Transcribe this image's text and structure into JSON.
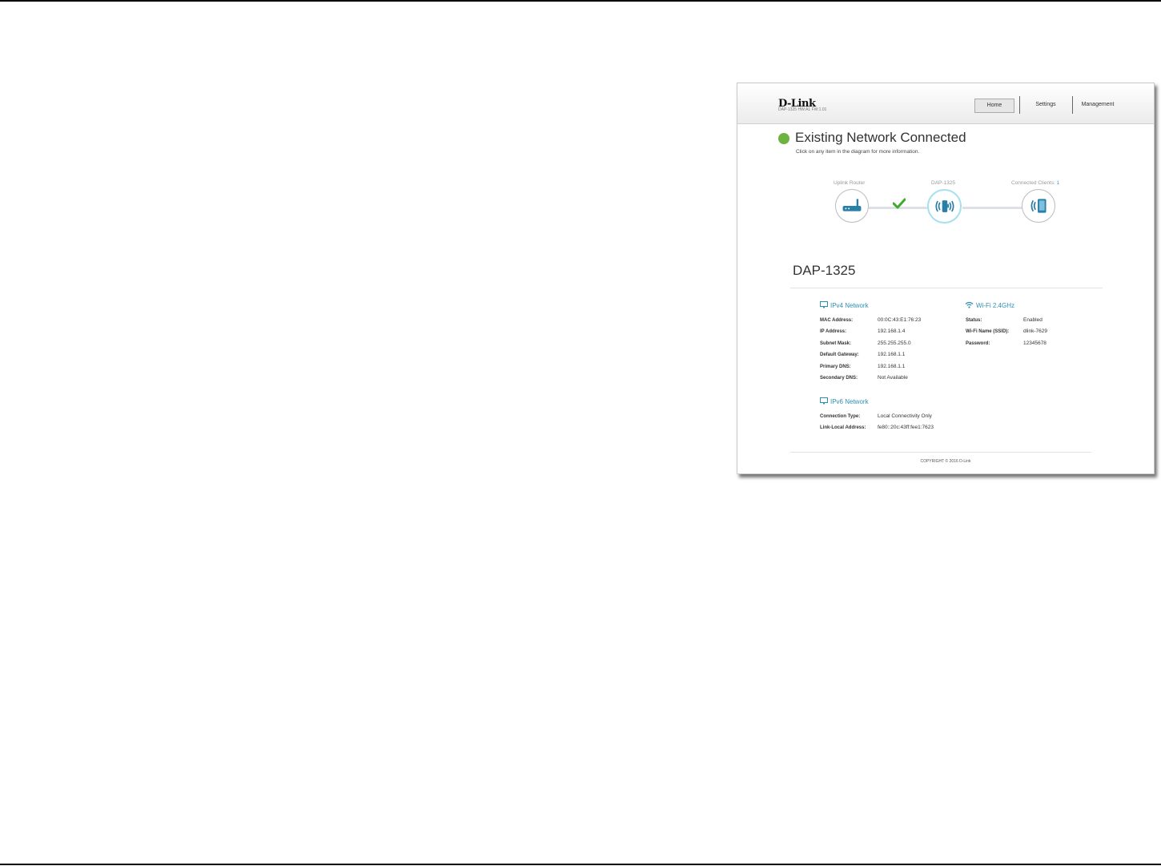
{
  "header": {
    "logo": "D-Link",
    "subtitle": "DAP-1325   HW:A1   FW:1.01",
    "nav": {
      "home": "Home",
      "settings": "Settings",
      "management": "Management"
    }
  },
  "status": {
    "title": "Existing Network Connected",
    "subtitle": "Click on any item in the diagram for more information.",
    "dot_color": "#6cb33f"
  },
  "diagram": {
    "uplink_label": "Uplink Router",
    "device_label": "DAP-1325",
    "clients_label": "Connected Clients:",
    "clients_count": "1",
    "icons": [
      "router-icon",
      "extender-icon",
      "client-device-icon",
      "check-icon"
    ]
  },
  "device": {
    "name": "DAP-1325",
    "ipv4": {
      "title": "IPv4 Network",
      "rows": [
        {
          "label": "MAC Address:",
          "value": "00:0C:43:E1:76:23"
        },
        {
          "label": "IP Address:",
          "value": "192.168.1.4"
        },
        {
          "label": "Subnet Mask:",
          "value": "255.255.255.0"
        },
        {
          "label": "Default Gateway:",
          "value": "192.168.1.1"
        },
        {
          "label": "Primary DNS:",
          "value": "192.168.1.1"
        },
        {
          "label": "Secondary DNS:",
          "value": "Not Available"
        }
      ]
    },
    "wifi": {
      "title": "Wi-Fi 2.4GHz",
      "rows": [
        {
          "label": "Status:",
          "value": "Enabled"
        },
        {
          "label": "Wi-Fi Name (SSID):",
          "value": "dlink-7629"
        },
        {
          "label": "Password:",
          "value": "12345678"
        }
      ]
    },
    "ipv6": {
      "title": "IPv6 Network",
      "rows": [
        {
          "label": "Connection Type:",
          "value": "Local Connectivity Only"
        },
        {
          "label": "Link-Local Address:",
          "value": "fe80::20c:43ff:fee1:7623"
        }
      ]
    }
  },
  "footer": {
    "copyright": "COPYRIGHT © 2016 D-Link"
  },
  "colors": {
    "accent": "#2f8fb5",
    "success": "#6cb33f"
  }
}
